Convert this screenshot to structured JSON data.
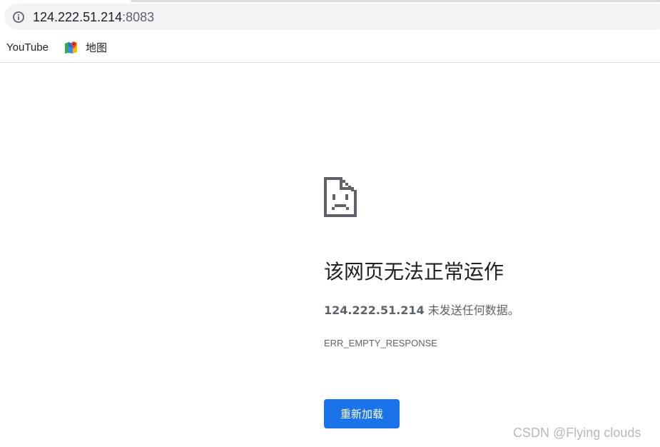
{
  "address_bar": {
    "host": "124.222.51.214",
    "port": ":8083",
    "info_icon": "info-icon"
  },
  "bookmarks": [
    {
      "label": "YouTube",
      "icon": null
    },
    {
      "label": "地图",
      "icon": "google-maps-icon"
    }
  ],
  "error": {
    "icon": "sad-file-icon",
    "title": "该网页无法正常运作",
    "host": "124.222.51.214",
    "message": " 未发送任何数据。",
    "code": "ERR_EMPTY_RESPONSE",
    "reload_label": "重新加载"
  },
  "watermark": "CSDN @Flying  clouds",
  "colors": {
    "accent": "#1a73e8",
    "omnibox_bg": "#f1f3f4",
    "text": "#202124",
    "secondary_text": "#5f6368"
  }
}
